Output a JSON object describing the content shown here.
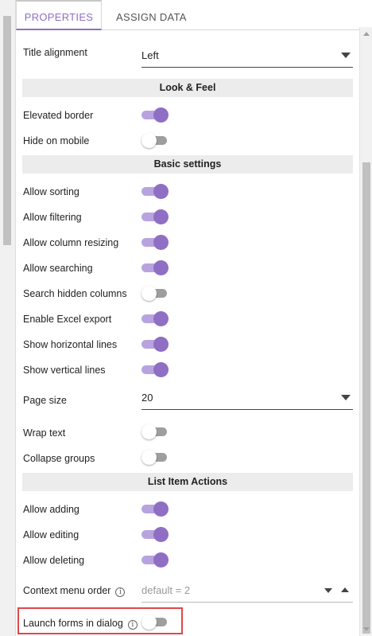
{
  "tabs": [
    {
      "label": "PROPERTIES",
      "active": true
    },
    {
      "label": "ASSIGN DATA",
      "active": false
    }
  ],
  "title_alignment": {
    "label": "Title alignment",
    "value": "Left"
  },
  "sections": {
    "look_feel": "Look & Feel",
    "basic_settings": "Basic settings",
    "list_item_actions": "List Item Actions"
  },
  "toggles": {
    "elevated_border": {
      "label": "Elevated border",
      "on": true
    },
    "hide_on_mobile": {
      "label": "Hide on mobile",
      "on": false
    },
    "allow_sorting": {
      "label": "Allow sorting",
      "on": true
    },
    "allow_filtering": {
      "label": "Allow filtering",
      "on": true
    },
    "allow_column_resizing": {
      "label": "Allow column resizing",
      "on": true
    },
    "allow_searching": {
      "label": "Allow searching",
      "on": true
    },
    "search_hidden_columns": {
      "label": "Search hidden columns",
      "on": false
    },
    "enable_excel_export": {
      "label": "Enable Excel export",
      "on": true
    },
    "show_horizontal_lines": {
      "label": "Show horizontal lines",
      "on": true
    },
    "show_vertical_lines": {
      "label": "Show vertical lines",
      "on": true
    },
    "wrap_text": {
      "label": "Wrap text",
      "on": false
    },
    "collapse_groups": {
      "label": "Collapse groups",
      "on": false
    },
    "allow_adding": {
      "label": "Allow adding",
      "on": true
    },
    "allow_editing": {
      "label": "Allow editing",
      "on": true
    },
    "allow_deleting": {
      "label": "Allow deleting",
      "on": true
    },
    "launch_forms_in_dialog": {
      "label": "Launch forms in dialog",
      "on": false
    }
  },
  "page_size": {
    "label": "Page size",
    "value": "20"
  },
  "context_menu_order": {
    "label": "Context menu order",
    "placeholder": "default = 2"
  },
  "info_glyph": "i",
  "colors": {
    "accent": "#8e6fc4",
    "accent_light": "#b9a3df",
    "off_track": "#9e9e9e",
    "highlight": "#e0474c"
  }
}
